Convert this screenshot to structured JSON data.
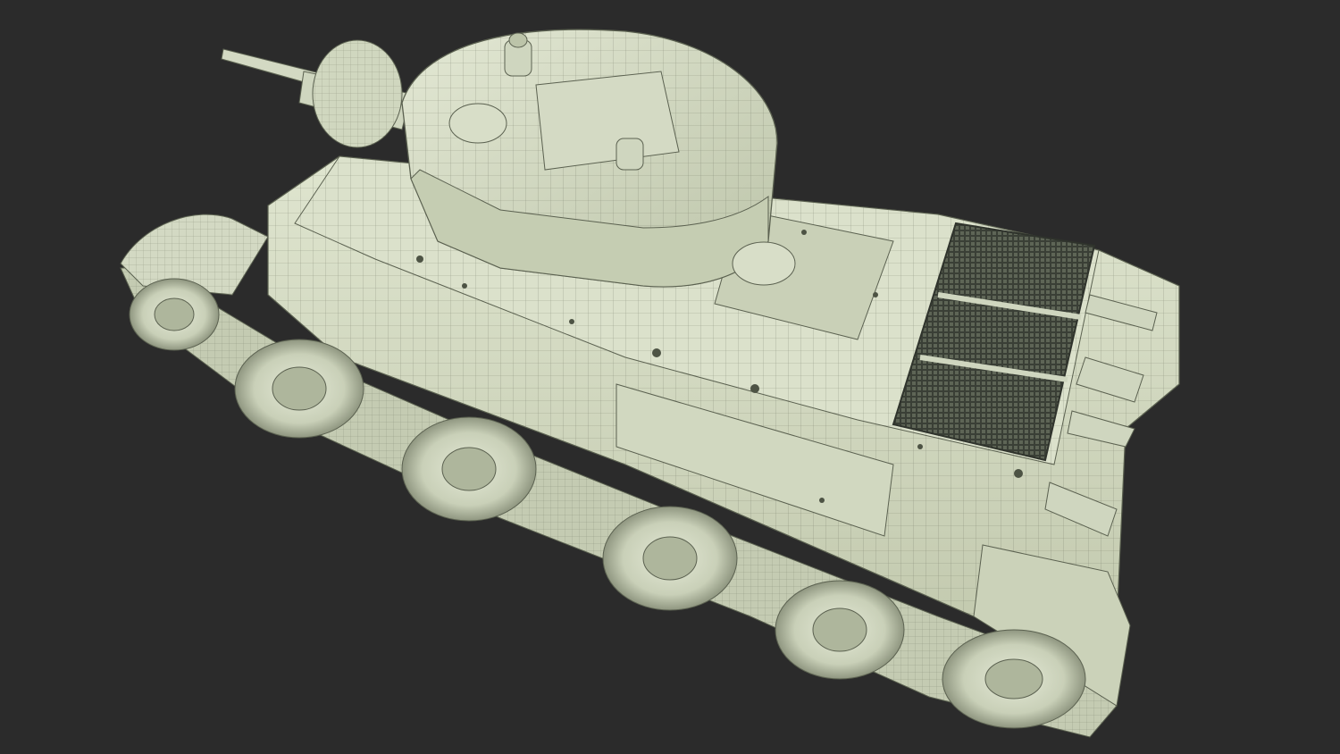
{
  "scene": {
    "background": "#2b2b2b",
    "subject": "wireframe-tank-model",
    "colors": {
      "hull": "#d9dfc9",
      "hull_shade": "#b9c1a7",
      "hull_dark": "#9ea68c",
      "wire": "#5b6150",
      "grille": "#2f332c",
      "wheel": "#cfd6bf",
      "wheel_dark": "#8e957d"
    },
    "road_wheel_count": 5,
    "icons": [
      "wheel-icon",
      "turret-hatch-icon",
      "engine-grille-icon",
      "exhaust-icon",
      "gun-barrel-icon"
    ]
  }
}
